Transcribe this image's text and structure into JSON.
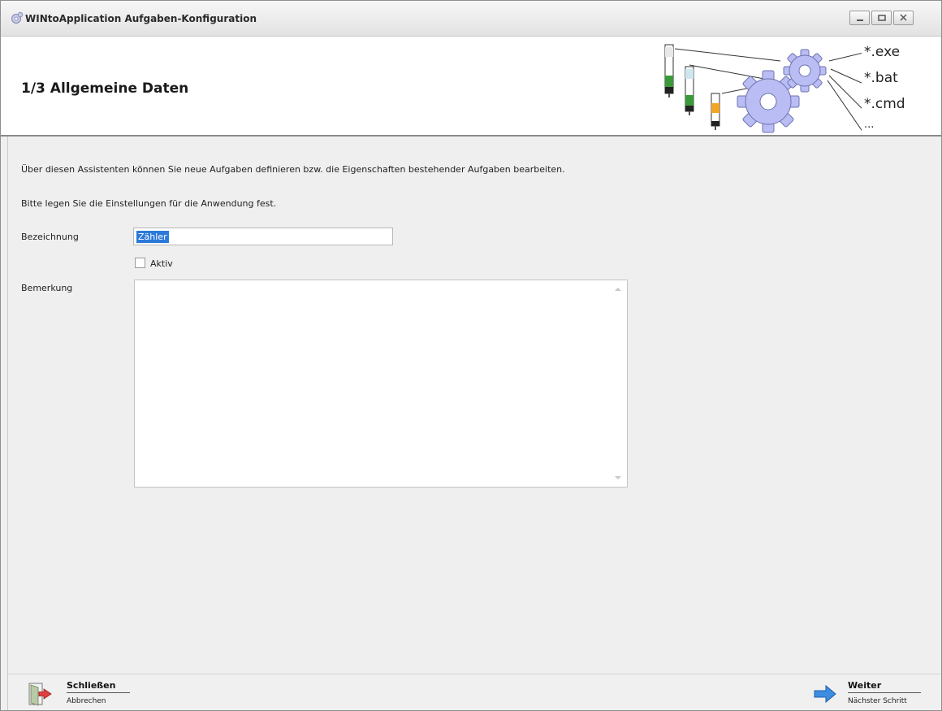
{
  "window": {
    "title": "WINtoApplication Aufgaben-Konfiguration",
    "controls": [
      "minimize-icon",
      "maximize-icon",
      "close-icon"
    ]
  },
  "header": {
    "step_title": "1/3 Allgemeine Daten",
    "extensions": [
      "*.exe",
      "*.bat",
      "*.cmd",
      "..."
    ]
  },
  "content": {
    "intro": "Über diesen Assistenten können Sie neue Aufgaben definieren bzw. die Eigenschaften bestehender Aufgaben bearbeiten.",
    "instruction": "Bitte legen Sie die Einstellungen für die Anwendung fest.",
    "name_label": "Bezeichnung",
    "name_value": "Zähler",
    "active_label": "Aktiv",
    "active_checked": false,
    "remark_label": "Bemerkung",
    "remark_value": ""
  },
  "footer": {
    "close": {
      "label": "Schließen",
      "sub": "Abbrechen"
    },
    "next": {
      "label": "Weiter",
      "sub": "Nächster Schritt"
    }
  },
  "colors": {
    "selection": "#2b79d9",
    "gear": "#b9bdf3",
    "next_arrow": "#3d8de2",
    "close_arrow": "#e04040"
  }
}
